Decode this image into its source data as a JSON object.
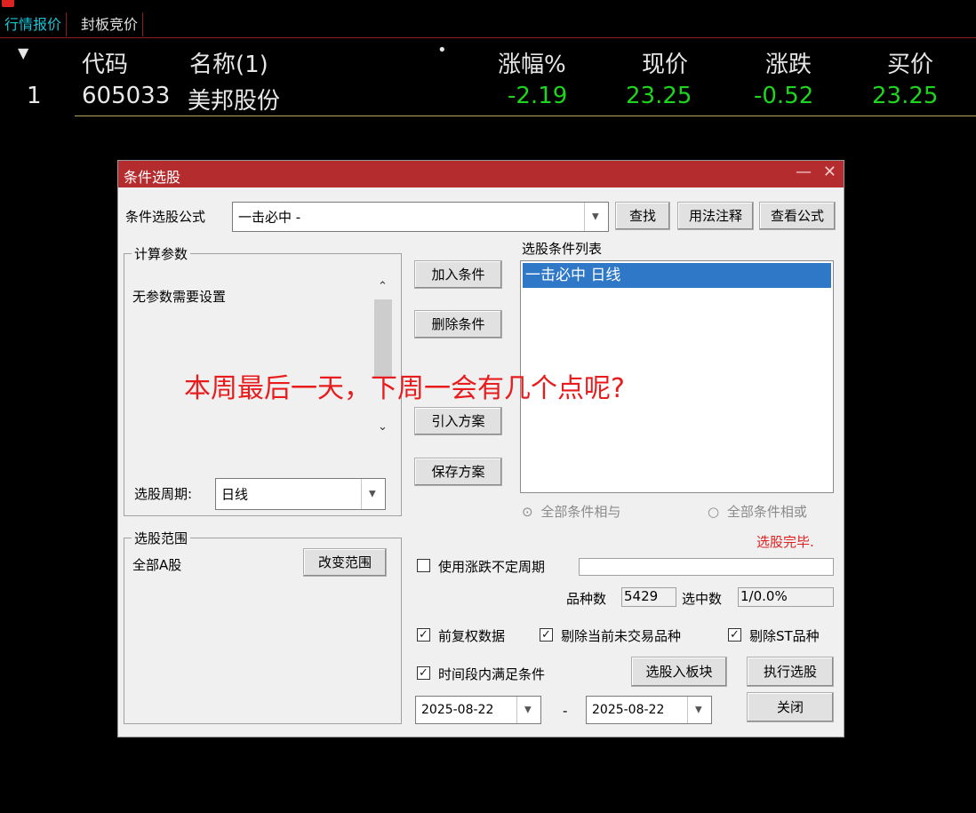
{
  "tabs": [
    {
      "label": "行情报价",
      "active": true
    },
    {
      "label": "封板竞价",
      "active": false
    }
  ],
  "grid": {
    "headers": {
      "sort_icon": "▼",
      "code": "代码",
      "name": "名称(1)",
      "dot": "•",
      "change_pct": "涨幅%",
      "price": "现价",
      "change": "涨跌",
      "bid": "买价"
    },
    "rows": [
      {
        "index": "1",
        "code": "605033",
        "name": "美邦股份",
        "change_pct": "-2.19",
        "price": "23.25",
        "change": "-0.52",
        "bid": "23.25"
      }
    ]
  },
  "dialog": {
    "title": "条件选股",
    "minimize": "—",
    "close": "✕",
    "formula_label": "条件选股公式",
    "formula_value": "一击必中 -",
    "find_button": "查找",
    "usage_button": "用法注释",
    "view_formula_button": "查看公式",
    "params_group": "计算参数",
    "params_text": "无参数需要设置",
    "period_label": "选股周期:",
    "period_value": "日线",
    "add_condition": "加入条件",
    "delete_condition": "删除条件",
    "import_plan": "引入方案",
    "save_plan": "保存方案",
    "conditions_list_label": "选股条件列表",
    "conditions": [
      "一击必中  日线"
    ],
    "radio_and": "全部条件相与",
    "radio_or": "全部条件相或",
    "status": "选股完毕.",
    "scope_group": "选股范围",
    "scope_value": "全部A股",
    "change_scope": "改变范围",
    "use_variable_period": "使用涨跌不定周期",
    "variety_count_label": "品种数",
    "variety_count": "5429",
    "selected_count_label": "选中数",
    "selected_count": "1/0.0%",
    "pre_adjusted": "前复权数据",
    "exclude_non_trading": "剔除当前未交易品种",
    "exclude_st": "剔除ST品种",
    "time_range": "时间段内满足条件",
    "to_block_button": "选股入板块",
    "execute_button": "执行选股",
    "date_from": "2025-08-22",
    "date_sep": "-",
    "date_to": "2025-08-22",
    "close_button": "关闭"
  },
  "overlay_text": "本周最后一天，下周一会有几个点呢?",
  "colors": {
    "accent_red": "#b52c2f",
    "cyan_tab": "#19c3d6",
    "green_down": "#1fd41f",
    "status_red": "#e02020",
    "overlay_red": "#e81c1c"
  }
}
